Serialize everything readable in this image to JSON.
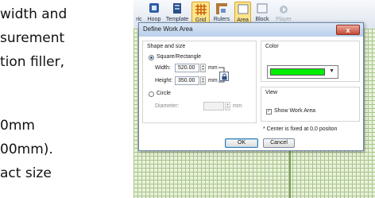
{
  "background_doc": {
    "lines": [
      "width and",
      "surement",
      "tion filler,",
      "0mm",
      "00mm).",
      "act size"
    ]
  },
  "toolbar": {
    "tools": [
      {
        "label": "ric",
        "icon": "partial-tool-icon"
      },
      {
        "label": "Hoop",
        "icon": "hoop-icon"
      },
      {
        "label": "Template",
        "icon": "template-icon"
      },
      {
        "label": "Grid",
        "icon": "grid-icon",
        "active": true
      },
      {
        "label": "Rulers",
        "icon": "rulers-icon"
      },
      {
        "label": "Area",
        "icon": "area-icon",
        "active": true
      },
      {
        "label": "Block",
        "icon": "block-icon"
      },
      {
        "label": "Player",
        "icon": "player-icon",
        "disabled": true
      }
    ]
  },
  "dialog": {
    "title": "Define Work Area",
    "close_label": "x",
    "shape_group": {
      "title": "Shape and size",
      "square_label": "Square/Rectangle",
      "width_label": "Width:",
      "width_value": "520.00",
      "height_label": "Height:",
      "height_value": "350.00",
      "unit": "mm",
      "circle_label": "Circle",
      "diameter_label": "Diameter:",
      "diameter_value": "",
      "diameter_unit": "mm",
      "selected": "square"
    },
    "color_group": {
      "title": "Color",
      "selected_color": "#00ee00"
    },
    "view_group": {
      "title": "View",
      "show_work_area_label": "Show Work Area",
      "show_work_area_checked": true
    },
    "note": "* Center is fixed at 0,0 positon",
    "ok_label": "OK",
    "cancel_label": "Cancel"
  },
  "colors": {
    "grid_line": "#a9c58c",
    "grid_bg": "#e9f1dc",
    "active_tool": "#fde48a"
  }
}
